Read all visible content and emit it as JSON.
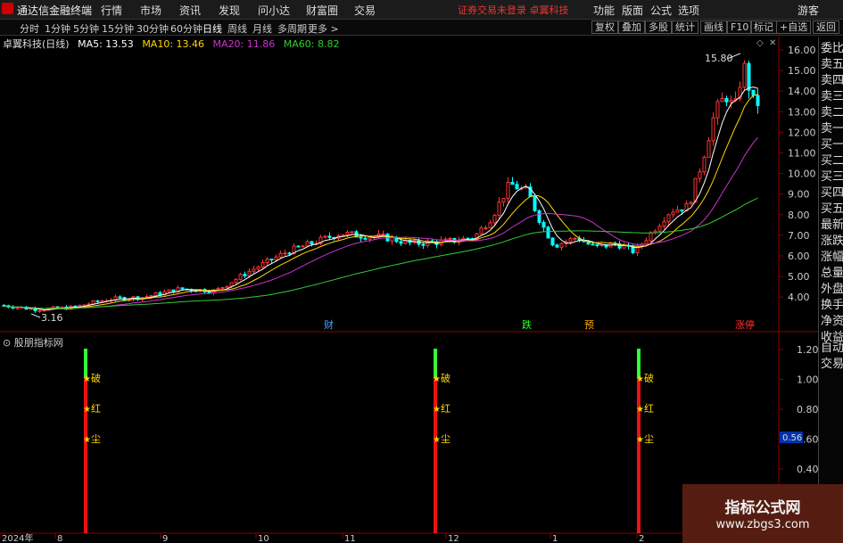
{
  "app": {
    "title": "通达信金融终端"
  },
  "top_menu": [
    "行情",
    "市场",
    "资讯",
    "发现",
    "问小达",
    "财富圈",
    "交易"
  ],
  "notice": "证券交易未登录  卓翼科技",
  "right_menu": [
    "功能",
    "版面",
    "公式",
    "选项"
  ],
  "guest": "游客",
  "periods": [
    "分时",
    "1分钟",
    "5分钟",
    "15分钟",
    "30分钟",
    "60分钟",
    "日线",
    "周线",
    "月线",
    "多周期",
    "更多 >"
  ],
  "active_period": "日线",
  "toolbar": [
    "复权",
    "叠加",
    "多股",
    "统计",
    "画线",
    "F10",
    "标记",
    "+自选",
    "返回"
  ],
  "stock_title": "卓翼科技(日线)",
  "ma": [
    {
      "label": "MA5: 13.53",
      "color": "#ffffff"
    },
    {
      "label": "MA10: 13.46",
      "color": "#ffd700"
    },
    {
      "label": "MA20: 11.86",
      "color": "#cc33cc"
    },
    {
      "label": "MA60: 8.82",
      "color": "#33cc33"
    }
  ],
  "price_axis": [
    "16.00",
    "15.00",
    "14.00",
    "13.00",
    "12.00",
    "11.00",
    "10.00",
    "9.00",
    "8.00",
    "7.00",
    "6.00",
    "5.00",
    "4.00"
  ],
  "high_label": "15.80",
  "low_label": "3.16",
  "event_tags": [
    {
      "text": "财",
      "color": "#4aa0ff"
    },
    {
      "text": "跌",
      "color": "#33ff33"
    },
    {
      "text": "预",
      "color": "#ffaa00"
    },
    {
      "text": "涨停",
      "color": "#ff3333"
    }
  ],
  "indicator_title": "股朋指标网",
  "indicator_axis": [
    "1.20",
    "1.00",
    "0.80",
    "0.60",
    "0.40"
  ],
  "indicator_value": "0.56",
  "signal_labels": [
    "破",
    "红",
    "尘"
  ],
  "star_glyph": "★",
  "date_axis": [
    "2024年",
    "8",
    "9",
    "10",
    "11",
    "12",
    "1",
    "2"
  ],
  "right_panel": [
    "委比",
    "卖五",
    "卖四",
    "卖三",
    "卖二",
    "卖一",
    "买一",
    "买二",
    "买三",
    "买四",
    "买五",
    "最新",
    "涨跌",
    "涨幅",
    "总量",
    "外盘",
    "换手",
    "净资",
    "收益",
    "自动",
    "交易"
  ],
  "watermark": {
    "line1": "指标公式网",
    "line2": "www.zbgs3.com"
  },
  "colors": {
    "up": "#ff3333",
    "down": "#00ffff",
    "ma5": "#ffffff",
    "ma10": "#ffd700",
    "ma20": "#cc33cc",
    "ma60": "#33cc33",
    "signal_top": "#33ff33",
    "signal_bar": "#ee1111"
  }
}
